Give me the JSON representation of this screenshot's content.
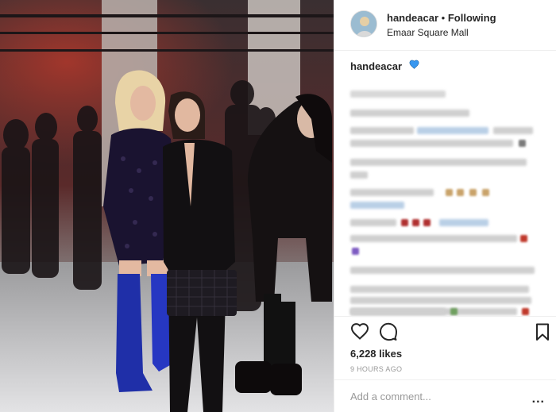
{
  "header": {
    "username": "handeacar",
    "separator": "•",
    "follow_status": "Following",
    "location": "Emaar Square Mall"
  },
  "caption": {
    "username": "handeacar"
  },
  "actions": {
    "like_icon": "heart-icon",
    "comment_icon": "comment-icon",
    "save_icon": "bookmark-icon"
  },
  "likes": "6,228 likes",
  "time_ago": "9 HOURS AGO",
  "comment_placeholder": "Add a comment...",
  "more_label": "...",
  "colors": {
    "verified": "#3897f0",
    "text": "#262626",
    "muted": "#999999",
    "border": "#efefef"
  }
}
